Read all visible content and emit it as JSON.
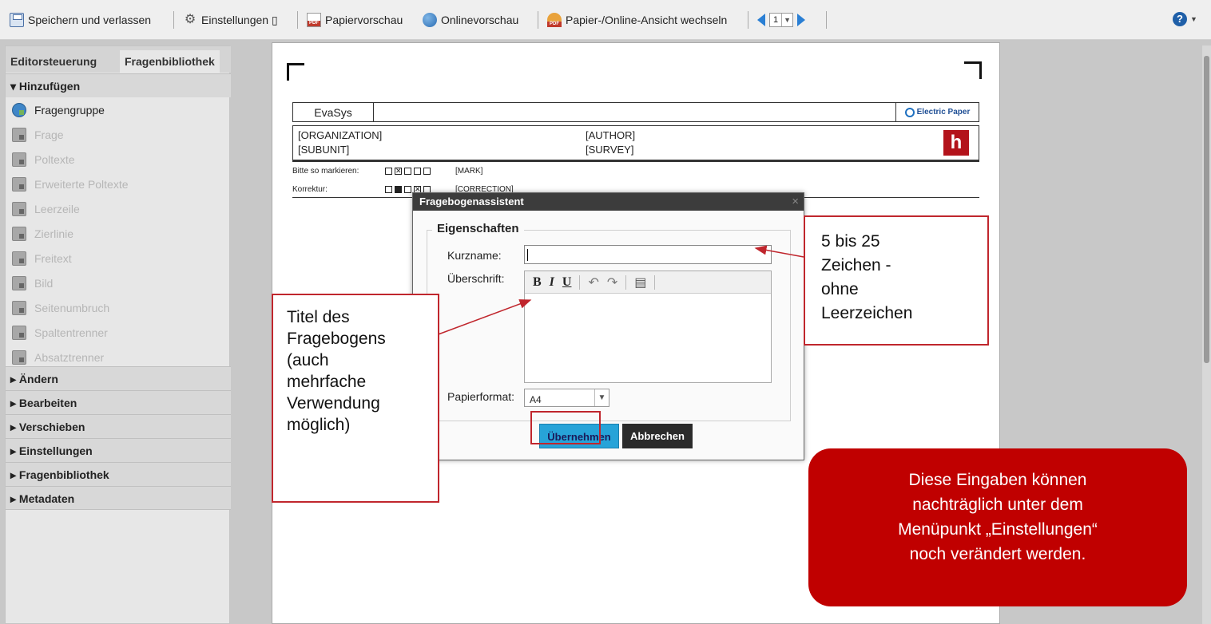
{
  "toolbar": {
    "save_exit": "Speichern und verlassen",
    "settings": "Einstellungen ▯",
    "paper_preview": "Papiervorschau",
    "online_preview": "Onlinevorschau",
    "switch_view": "Papier-/Online-Ansicht wechseln",
    "page_number": "1",
    "help": "?"
  },
  "sidebar": {
    "tabs": [
      "Editorsteuerung",
      "Fragenbibliothek"
    ],
    "section_add": "▾ Hinzufügen",
    "items": [
      {
        "label": "Fragengruppe",
        "enabled": true
      },
      {
        "label": "Frage",
        "enabled": false
      },
      {
        "label": "Poltexte",
        "enabled": false
      },
      {
        "label": "Erweiterte Poltexte",
        "enabled": false
      },
      {
        "label": "Leerzeile",
        "enabled": false
      },
      {
        "label": "Zierlinie",
        "enabled": false
      },
      {
        "label": "Freitext",
        "enabled": false
      },
      {
        "label": "Bild",
        "enabled": false
      },
      {
        "label": "Seitenumbruch",
        "enabled": false
      },
      {
        "label": "Spaltentrenner",
        "enabled": false
      },
      {
        "label": "Absatztrenner",
        "enabled": false
      }
    ],
    "sections": [
      "▸ Ändern",
      "▸ Bearbeiten",
      "▸ Verschieben",
      "▸ Einstellungen",
      "▸ Fragenbibliothek",
      "▸ Metadaten"
    ]
  },
  "page": {
    "brand": "EvaSys",
    "ep_logo": "Electric Paper",
    "organization": "[ORGANIZATION]",
    "author": "[AUTHOR]",
    "subunit": "[SUBUNIT]",
    "survey": "[SURVEY]",
    "mark_label": "Bitte so markieren:",
    "mark_placeholder": "[MARK]",
    "correction_label": "Korrektur:",
    "correction_placeholder": "[CORRECTION]",
    "hs_logo": "h"
  },
  "dialog": {
    "title": "Fragebogenassistent",
    "close": "×",
    "fieldset": "Eigenschaften",
    "short_name_label": "Kurzname:",
    "short_name_value": "",
    "heading_label": "Überschrift:",
    "editor_buttons": [
      "B",
      "I",
      "U",
      "↶",
      "↷",
      "▤"
    ],
    "paper_label": "Papierformat:",
    "paper_value": "A4",
    "ok": "Übernehmen",
    "cancel": "Abbrechen"
  },
  "annotations": {
    "left_lines": [
      "Titel des",
      "Fragebogens",
      "(auch",
      "mehrfache",
      "Verwendung",
      "möglich)"
    ],
    "right_lines": [
      "5 bis 25",
      "Zeichen -",
      "ohne",
      "Leerzeichen"
    ],
    "info_lines": [
      "Diese Eingaben können",
      "nachträglich unter dem",
      "Menüpunkt „Einstellungen“",
      "noch verändert werden."
    ]
  },
  "colors": {
    "annotation_red": "#c0262d",
    "bubble_red": "#c00000",
    "ok_button": "#27a3d8"
  }
}
